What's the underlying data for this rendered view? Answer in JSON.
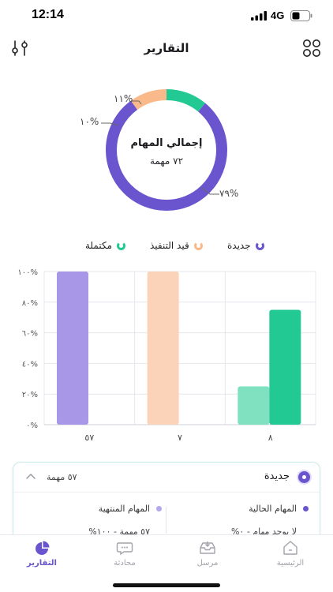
{
  "status_bar": {
    "time": "12:14",
    "network": "4G"
  },
  "header": {
    "title": "التقارير",
    "filter_icon": "sliders-icon",
    "grid_icon": "grid-icon"
  },
  "donut": {
    "center_title": "إجمالي المهام",
    "center_sub": "٧٢ مهمة",
    "segments": [
      {
        "name": "جديدة",
        "percent": 79,
        "label": "٧٩%",
        "color": "#6b55cf"
      },
      {
        "name": "قيد التنفيذ",
        "percent": 10,
        "label": "١٠%",
        "color": "#f9b98a"
      },
      {
        "name": "مكتملة",
        "percent": 11,
        "label": "١١%",
        "color": "#23c993"
      }
    ]
  },
  "legend": [
    {
      "label": "جديدة",
      "color": "#6b55cf"
    },
    {
      "label": "قيد التنفيذ",
      "color": "#f9b98a"
    },
    {
      "label": "مكتملة",
      "color": "#23c993"
    }
  ],
  "chart_data": {
    "type": "bar",
    "categories": [
      "٥٧",
      "٧",
      "٨"
    ],
    "y_tick_labels": [
      "٠%",
      "٢٠%",
      "٤٠%",
      "٦٠%",
      "٨٠%",
      "١٠٠%"
    ],
    "ylim": [
      0,
      100
    ],
    "bars": [
      {
        "category": "٥٧",
        "value": 100,
        "color": "#a797e6"
      },
      {
        "category": "٧",
        "value": 100,
        "color": "#fbd3b8"
      },
      {
        "category": "٨",
        "value": 25,
        "color": "#7fe1c0"
      },
      {
        "category": "٨",
        "value": 75,
        "color": "#23c993"
      }
    ],
    "grid": true
  },
  "task_card": {
    "status": "جديدة",
    "count": "٥٧ مهمة",
    "current_label": "المهام الحالية",
    "current_value": "لا يوجد مهام - ٠%",
    "finished_label": "المهام المنتهية",
    "finished_value": "٥٧ مهمة - ١٠٠%",
    "accent": "#6b55cf",
    "finished_bullet": "#b3a8ee"
  },
  "tabs": [
    {
      "label": "التقارير",
      "icon": "pie-chart-icon",
      "active": true
    },
    {
      "label": "محادثة",
      "icon": "chat-icon",
      "active": false
    },
    {
      "label": "مرسل",
      "icon": "inbox-icon",
      "active": false
    },
    {
      "label": "الرئيسية",
      "icon": "home-icon",
      "active": false
    }
  ]
}
